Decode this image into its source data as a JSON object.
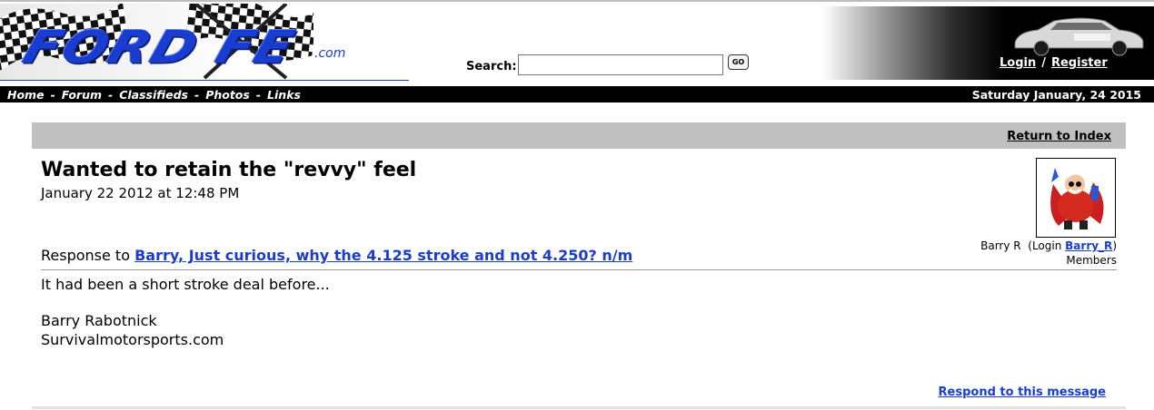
{
  "header": {
    "logo_text": "FORD FE",
    "logo_suffix": ".com",
    "search_label": "Search:",
    "search_value": "",
    "go_label": "GO",
    "login_label": "Login",
    "separator": "/",
    "register_label": "Register"
  },
  "nav": {
    "items": [
      "Home",
      "Forum",
      "Classifieds",
      "Photos",
      "Links"
    ],
    "separator": "-",
    "date": "Saturday January, 24 2015"
  },
  "message": {
    "return_label": "Return to Index",
    "title": "Wanted to retain the \"revvy\" feel",
    "date": "January 22 2012 at 12:48 PM",
    "response_prefix": "Response to",
    "response_link": "Barry, Just curious, why the 4.125 stroke and not 4.250? n/m",
    "body": "It had been a short stroke deal before...",
    "signature_line1": "Barry Rabotnick",
    "signature_line2": "Survivalmotorsports.com",
    "respond_label": "Respond to this message"
  },
  "author": {
    "name": "Barry R",
    "login_prefix": "(Login",
    "login_name": "Barry_R",
    "login_suffix": ")",
    "role": "Members"
  },
  "colors": {
    "link_blue": "#1a3ccf",
    "nav_bg": "#000000",
    "bar_gray": "#c0c0c0"
  }
}
